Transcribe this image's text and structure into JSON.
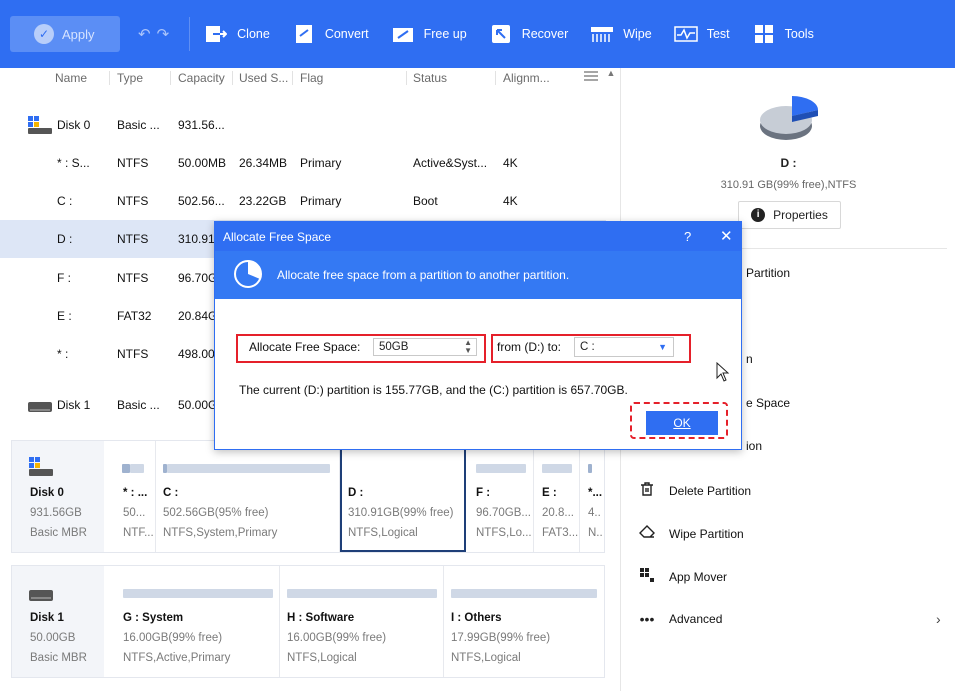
{
  "toolbar": {
    "apply": "Apply",
    "clone": "Clone",
    "convert": "Convert",
    "free_up": "Free up",
    "recover": "Recover",
    "wipe": "Wipe",
    "test": "Test",
    "tools": "Tools"
  },
  "columns": [
    "Name",
    "Type",
    "Capacity",
    "Used S...",
    "Flag",
    "Status",
    "Alignm..."
  ],
  "rows": [
    {
      "name": "Disk 0",
      "type": "Basic ...",
      "capacity": "931.56...",
      "used": "",
      "flag": "",
      "status": "",
      "align": ""
    },
    {
      "name": "* : S...",
      "type": "NTFS",
      "capacity": "50.00MB",
      "used": "26.34MB",
      "flag": "Primary",
      "status": "Active&Syst...",
      "align": "4K"
    },
    {
      "name": "C :",
      "type": "NTFS",
      "capacity": "502.56...",
      "used": "23.22GB",
      "flag": "Primary",
      "status": "Boot",
      "align": "4K"
    },
    {
      "name": "D :",
      "type": "NTFS",
      "capacity": "310.91G",
      "used": "",
      "flag": "",
      "status": "",
      "align": ""
    },
    {
      "name": "F :",
      "type": "NTFS",
      "capacity": "96.70G",
      "used": "",
      "flag": "",
      "status": "",
      "align": ""
    },
    {
      "name": "E :",
      "type": "FAT32",
      "capacity": "20.84G",
      "used": "",
      "flag": "",
      "status": "",
      "align": ""
    },
    {
      "name": "* :",
      "type": "NTFS",
      "capacity": "498.00",
      "used": "",
      "flag": "",
      "status": "",
      "align": ""
    },
    {
      "name": "Disk 1",
      "type": "Basic ...",
      "capacity": "50.00G",
      "used": "",
      "flag": "",
      "status": "",
      "align": ""
    }
  ],
  "disk0": {
    "name": "Disk 0",
    "size": "931.56GB",
    "type": "Basic MBR",
    "parts": [
      {
        "label": "* : ...",
        "line2": "50...",
        "line3": "NTF..."
      },
      {
        "label": "C :",
        "line2": "502.56GB(95% free)",
        "line3": "NTFS,System,Primary"
      },
      {
        "label": "D :",
        "line2": "310.91GB(99% free)",
        "line3": "NTFS,Logical"
      },
      {
        "label": "F :",
        "line2": "96.70GB...",
        "line3": "NTFS,Lo..."
      },
      {
        "label": "E :",
        "line2": "20.8...",
        "line3": "FAT3..."
      },
      {
        "label": "*...",
        "line2": "4..",
        "line3": "N.."
      }
    ]
  },
  "disk1": {
    "name": "Disk 1",
    "size": "50.00GB",
    "type": "Basic MBR",
    "parts": [
      {
        "label": "G : System",
        "line2": "16.00GB(99% free)",
        "line3": "NTFS,Active,Primary"
      },
      {
        "label": "H : Software",
        "line2": "16.00GB(99% free)",
        "line3": "NTFS,Logical"
      },
      {
        "label": "I : Others",
        "line2": "17.99GB(99% free)",
        "line3": "NTFS,Logical"
      }
    ]
  },
  "right_panel": {
    "drive": "D :",
    "drive_info": "310.91 GB(99% free),NTFS",
    "properties": "Properties",
    "items": [
      "Partition",
      "n",
      "e Space",
      "ion",
      "Delete Partition",
      "Wipe Partition",
      "App Mover",
      "Advanced"
    ]
  },
  "dialog": {
    "title": "Allocate Free Space",
    "help": "?",
    "close": "✕",
    "banner": "Allocate free space from a partition to another partition.",
    "allocate_label": "Allocate Free Space:",
    "allocate_value": "50GB",
    "from_label": "from (D:) to:",
    "to_value": "C :",
    "info": "The current (D:) partition is 155.77GB, and the (C:) partition is 657.70GB.",
    "ok": "OK"
  }
}
